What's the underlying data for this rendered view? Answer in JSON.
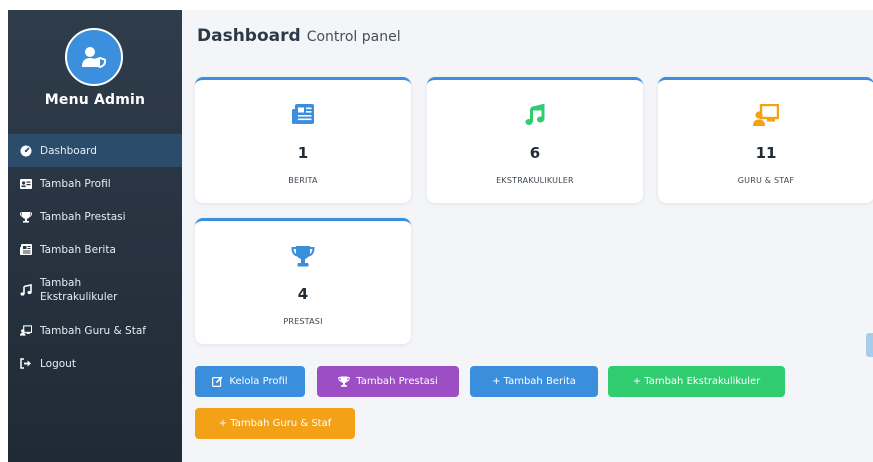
{
  "sidebar": {
    "title": "Menu Admin",
    "items": [
      {
        "label": "Dashboard",
        "icon": "dashboard-icon"
      },
      {
        "label": "Tambah Profil",
        "icon": "id-card-icon"
      },
      {
        "label": "Tambah Prestasi",
        "icon": "trophy-icon"
      },
      {
        "label": "Tambah Berita",
        "icon": "newspaper-icon"
      },
      {
        "label": "Tambah Ekstrakulikuler",
        "icon": "music-icon"
      },
      {
        "label": "Tambah Guru & Staf",
        "icon": "teacher-icon"
      },
      {
        "label": "Logout",
        "icon": "logout-icon"
      }
    ]
  },
  "header": {
    "title": "Dashboard",
    "subtitle": "Control panel"
  },
  "cards": [
    {
      "value": "1",
      "label": "BERITA",
      "icon": "newspaper-icon",
      "color": "#3a8edc"
    },
    {
      "value": "6",
      "label": "EKSTRAKULIKULER",
      "icon": "music-icon",
      "color": "#2fcc70"
    },
    {
      "value": "11",
      "label": "GURU & STAF",
      "icon": "teacher-icon",
      "color": "#f3a116"
    },
    {
      "value": "4",
      "label": "PRESTASI",
      "icon": "trophy-icon",
      "color": "#3a8edc"
    }
  ],
  "buttons": [
    {
      "label": "Kelola Profil",
      "icon": "edit-icon",
      "color": "#3a8edc"
    },
    {
      "label": "Tambah Prestasi",
      "icon": "trophy-icon",
      "color": "#9c4fc4"
    },
    {
      "label": "+ Tambah Berita",
      "color": "#3a8edc"
    },
    {
      "label": "+ Tambah Ekstrakulikuler",
      "color": "#2fcc70"
    },
    {
      "label": "+ Tambah Guru & Staf",
      "color": "#f3a116"
    }
  ]
}
